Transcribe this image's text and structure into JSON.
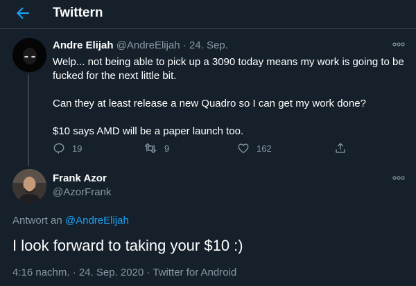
{
  "header": {
    "title": "Twittern",
    "back_icon": "arrow-left-icon",
    "accent": "#1da1f2"
  },
  "tweet1": {
    "name": "Andre Elijah",
    "handle": "@AndreElijah",
    "separator": "·",
    "date": "24. Sep.",
    "paragraphs": [
      "Welp... not being able to pick up a 3090 today means my work is going to be fucked for the next little bit.",
      "Can they at least release a new Quadro so I can get my work done?",
      "$10 says AMD will be a paper launch too."
    ],
    "replies": "19",
    "retweets": "9",
    "likes": "162",
    "icons": [
      "reply-icon",
      "retweet-icon",
      "like-icon",
      "share-icon",
      "more-icon"
    ]
  },
  "tweet2": {
    "name": "Frank Azor",
    "handle": "@AzorFrank",
    "reply_prefix": "Antwort an",
    "reply_to": "@AndreElijah",
    "text": "I look forward to taking your $10 :)",
    "meta": "4:16 nachm. · 24. Sep. 2020 · Twitter for Android"
  },
  "colors": {
    "background": "#15202b",
    "muted": "#8899a6",
    "border": "#38444d",
    "link": "#1da1f2"
  }
}
